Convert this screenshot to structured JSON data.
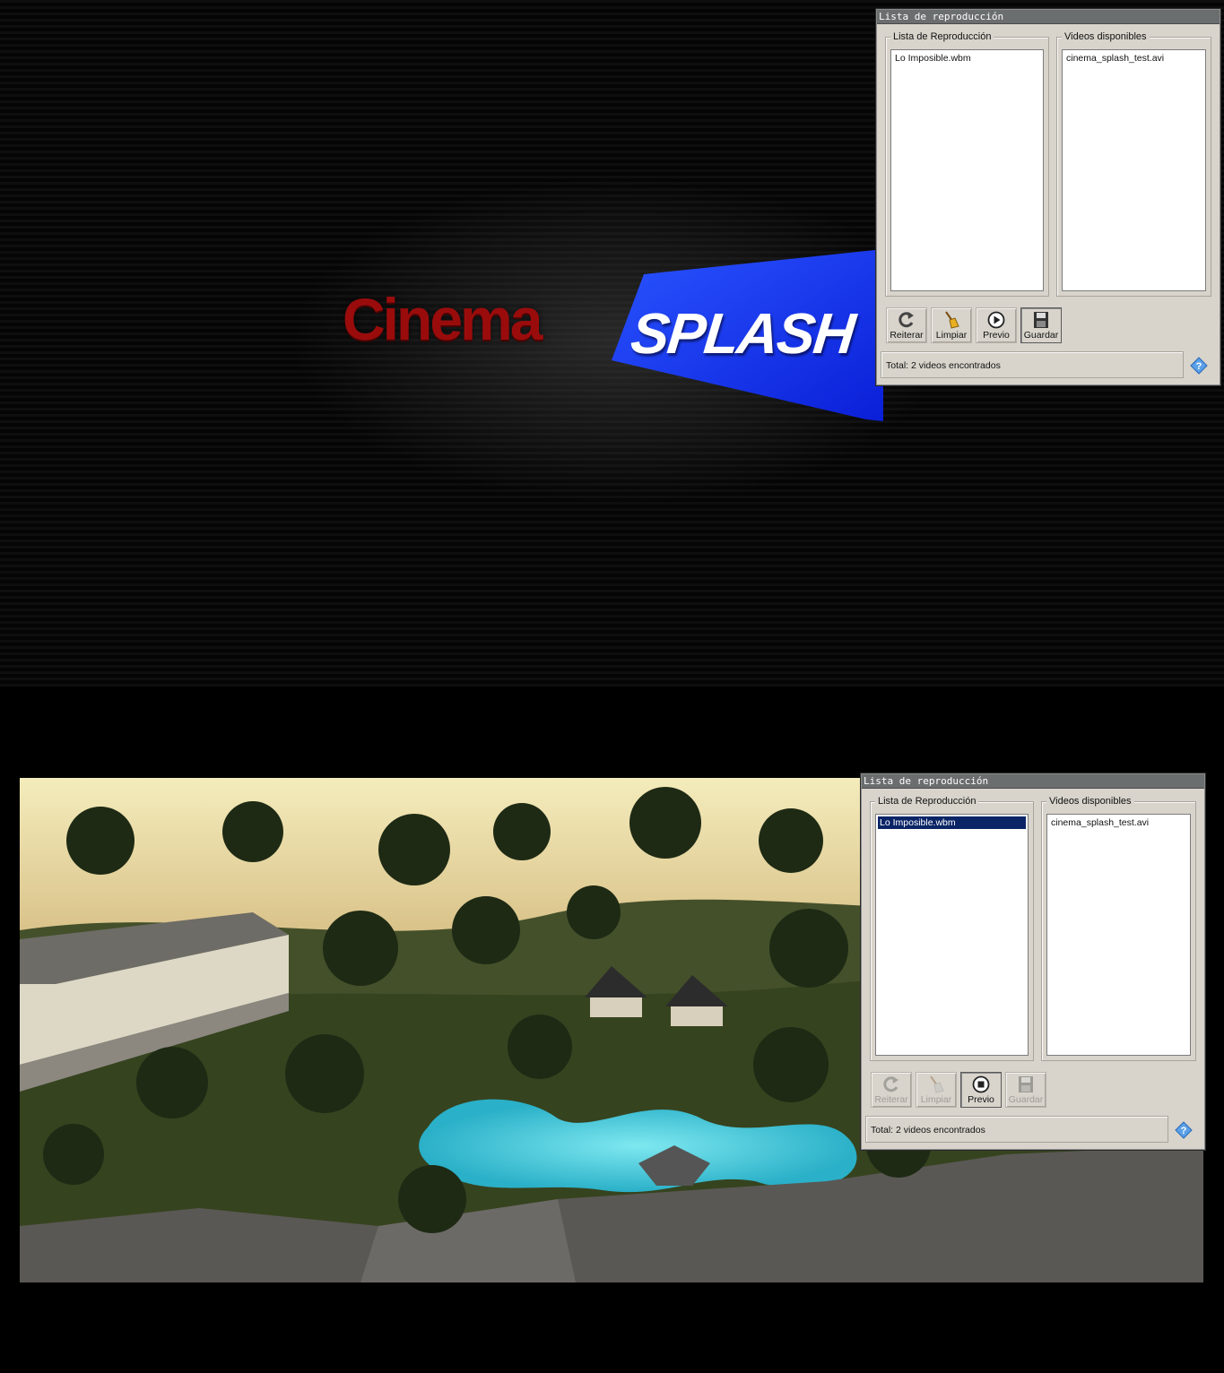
{
  "splash": {
    "logo_cinema": "Cinema",
    "logo_splash": "SPLASH",
    "brand_colors": {
      "cinema_red": "#9a0c0c",
      "splash_blue": "#1430f0"
    }
  },
  "windows": [
    {
      "title": "Lista de reproducción",
      "playlist": {
        "label": "Lista de Reproducción",
        "items": [
          "Lo Imposible.wbm"
        ],
        "selected_index": null
      },
      "available": {
        "label": "Videos disponibles",
        "items": [
          "cinema_splash_test.avi"
        ]
      },
      "toolbar": [
        {
          "label": "Reiterar",
          "icon": "repeat-icon",
          "enabled": true,
          "pressed": false
        },
        {
          "label": "Limpiar",
          "icon": "broom-icon",
          "enabled": true,
          "pressed": false
        },
        {
          "label": "Previo",
          "icon": "play-icon",
          "enabled": true,
          "pressed": false
        },
        {
          "label": "Guardar",
          "icon": "floppy-disk-icon",
          "enabled": true,
          "pressed": true
        }
      ],
      "status": "Total: 2 videos encontrados"
    },
    {
      "title": "Lista de reproducción",
      "playlist": {
        "label": "Lista de Reproducción",
        "items": [
          "Lo Imposible.wbm"
        ],
        "selected_index": 0
      },
      "available": {
        "label": "Videos disponibles",
        "items": [
          "cinema_splash_test.avi"
        ]
      },
      "toolbar": [
        {
          "label": "Reiterar",
          "icon": "repeat-icon",
          "enabled": false,
          "pressed": false
        },
        {
          "label": "Limpiar",
          "icon": "broom-icon",
          "enabled": false,
          "pressed": false
        },
        {
          "label": "Previo",
          "icon": "stop-icon",
          "enabled": true,
          "pressed": true
        },
        {
          "label": "Guardar",
          "icon": "floppy-disk-icon",
          "enabled": false,
          "pressed": false
        }
      ],
      "status": "Total: 2 videos encontrados"
    }
  ]
}
